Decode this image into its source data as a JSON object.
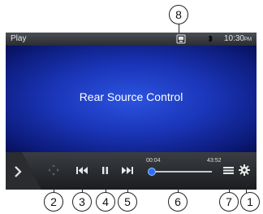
{
  "status_bar": {
    "title": "Play",
    "time": "10:30",
    "ampm": "PM",
    "source_icon": "rear-source-icon",
    "bluetooth_icon": "bluetooth-icon"
  },
  "main": {
    "title": "Rear Source Control"
  },
  "controls": {
    "menu_toggle_icon": "chevron-right-icon",
    "directional_icon": "directional-pad-icon",
    "prev_icon": "skip-previous-icon",
    "pause_icon": "pause-icon",
    "next_icon": "skip-next-icon",
    "list_icon": "list-icon",
    "settings_icon": "gear-icon"
  },
  "progress": {
    "current": "00:04",
    "total": "43:52",
    "fraction": 0.0015
  },
  "callouts": [
    "1",
    "2",
    "3",
    "4",
    "5",
    "6",
    "7",
    "8"
  ],
  "colors": {
    "screen_blue": "#1a35b8",
    "progress_knob": "#2e6ef5",
    "bar_dark": "#1b1d20"
  }
}
